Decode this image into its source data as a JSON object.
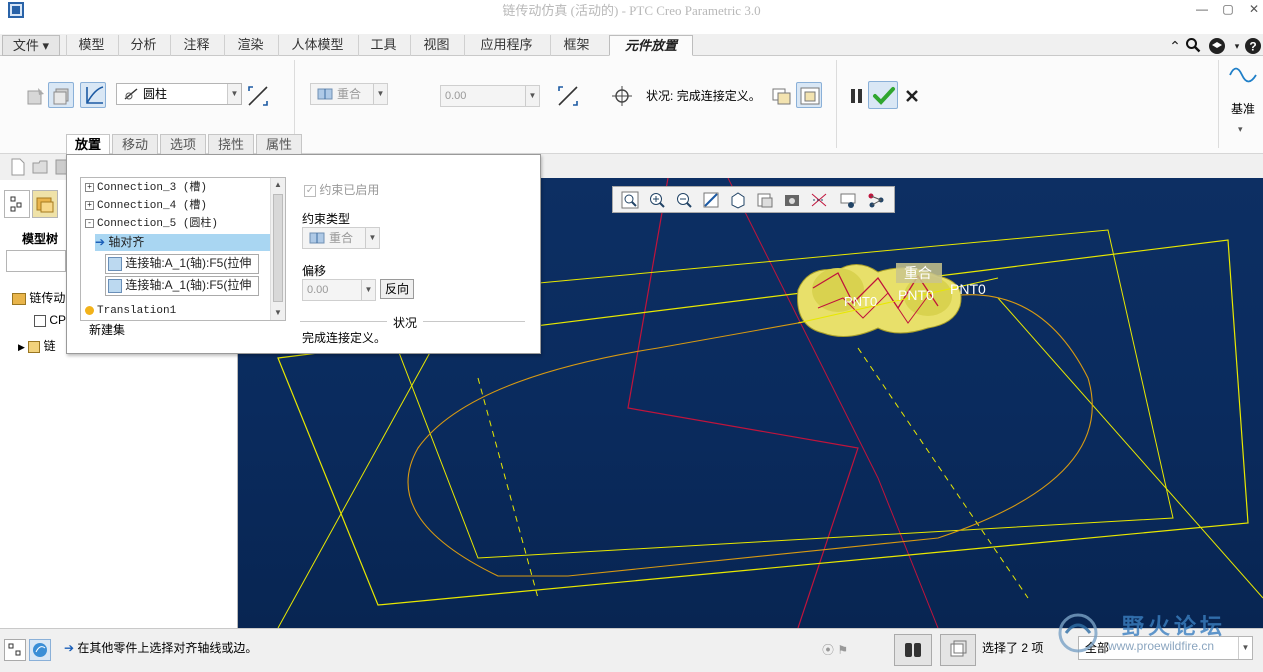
{
  "window": {
    "title": "链传动仿真 (活动的) - PTC Creo Parametric 3.0"
  },
  "ribbon_tabs": [
    {
      "label": "文件",
      "has_dropdown": true
    },
    {
      "label": "模型"
    },
    {
      "label": "分析"
    },
    {
      "label": "注释"
    },
    {
      "label": "渲染"
    },
    {
      "label": "人体模型"
    },
    {
      "label": "工具"
    },
    {
      "label": "视图"
    },
    {
      "label": "应用程序"
    },
    {
      "label": "框架"
    },
    {
      "label": "元件放置",
      "active": true
    }
  ],
  "ribbon": {
    "connection_type": "圆柱",
    "constraint_type": "重合",
    "offset_value": "0.00",
    "status_label": "状况:",
    "status_text": "完成连接定义。",
    "datum_label": "基准"
  },
  "subtabs": [
    {
      "label": "放置",
      "active": true
    },
    {
      "label": "移动"
    },
    {
      "label": "选项"
    },
    {
      "label": "挠性"
    },
    {
      "label": "属性"
    }
  ],
  "placement_panel": {
    "tree": [
      {
        "label": "Connection_3 (槽)",
        "expander": "+"
      },
      {
        "label": "Connection_4 (槽)",
        "expander": "+"
      },
      {
        "label": "Connection_5 (圆柱)",
        "expander": "-"
      },
      {
        "label": "轴对齐",
        "selected": true
      },
      {
        "label": "连接轴:A_1(轴):F5(拉伸"
      },
      {
        "label": "连接轴:A_1(轴):F5(拉伸"
      },
      {
        "label": "Translation1"
      }
    ],
    "new_set": "新建集",
    "constraint_enabled": "约束已启用",
    "constraint_type_label": "约束类型",
    "constraint_type_value": "重合",
    "offset_label": "偏移",
    "offset_value": "0.00",
    "flip_button": "反向",
    "status_label": "状况",
    "status_text": "完成连接定义。"
  },
  "left_panel": {
    "model_tree_label": "模型树",
    "items": [
      {
        "label": "链传动"
      },
      {
        "label": "CP"
      },
      {
        "label": "链"
      }
    ]
  },
  "graphics": {
    "overlay_label_coincident": "重合",
    "point_labels": [
      "PNT0",
      "PNT0",
      "PNT0"
    ]
  },
  "statusbar": {
    "message": "在其他零件上选择对齐轴线或边。",
    "selection_count": "选择了 2 项",
    "filter": "全部",
    "watermark_title": "野火论坛",
    "watermark_url": "www.proewildfire.cn"
  },
  "colors": {
    "graphics_bg": "#0b2c5e",
    "wire_yellow": "#e8e800",
    "wire_orange": "#d89a12",
    "wire_red": "#c0143c",
    "accept_green": "#2fa62f"
  }
}
